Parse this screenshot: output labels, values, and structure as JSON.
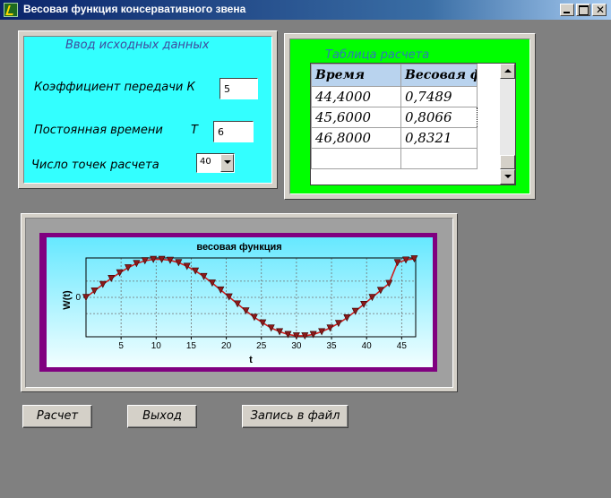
{
  "window": {
    "title": "Весовая функция консервативного звена",
    "controls": [
      "minimize",
      "maximize",
      "close"
    ],
    "close_glyph": "✕"
  },
  "input_panel": {
    "title": "Ввод исходных данных",
    "gain_label": "Коэффициент передачи К",
    "gain_value": "5",
    "time_const_label": "Постоянная времени",
    "time_const_symbol": "T",
    "time_const_value": "6",
    "points_label": "Число точек расчета",
    "points_value": "40"
  },
  "table_panel": {
    "title": "Таблица расчета",
    "columns": [
      "Время",
      "Весовая ф"
    ],
    "rows": [
      [
        "44,4000",
        "0,7489"
      ],
      [
        "45,6000",
        "0,8066"
      ],
      [
        "46,8000",
        "0,8321"
      ],
      [
        "",
        ""
      ]
    ]
  },
  "chart_data": {
    "type": "line",
    "title": "весовая функция",
    "xlabel": "t",
    "ylabel": "W(t)",
    "xlim": [
      0,
      47
    ],
    "ylim": [
      -0.85,
      0.85
    ],
    "xticks": [
      5,
      10,
      15,
      20,
      25,
      30,
      35,
      40,
      45
    ],
    "yticks": [
      0
    ],
    "grid": true,
    "marker": "triangle-down",
    "series": [
      {
        "color": "#cc2020",
        "x": [
          0,
          1.2,
          2.4,
          3.6,
          4.8,
          6,
          7.2,
          8.4,
          9.6,
          10.8,
          12,
          13.2,
          14.4,
          15.6,
          16.8,
          18,
          19.2,
          20.4,
          21.6,
          22.8,
          24,
          25.2,
          26.4,
          27.6,
          28.8,
          30,
          31.2,
          32.4,
          33.6,
          34.8,
          36,
          37.2,
          38.4,
          39.6,
          40.8,
          42,
          43.2,
          44.4,
          45.6,
          46.8
        ],
        "y": [
          0,
          0.14,
          0.28,
          0.41,
          0.53,
          0.64,
          0.73,
          0.79,
          0.82,
          0.82,
          0.8,
          0.75,
          0.67,
          0.57,
          0.45,
          0.31,
          0.16,
          0.01,
          -0.14,
          -0.29,
          -0.43,
          -0.55,
          -0.66,
          -0.74,
          -0.8,
          -0.83,
          -0.83,
          -0.8,
          -0.74,
          -0.66,
          -0.56,
          -0.44,
          -0.3,
          -0.15,
          0.0,
          0.15,
          0.3,
          0.7489,
          0.8066,
          0.8321
        ]
      }
    ]
  },
  "buttons": {
    "calc": "Расчет",
    "exit": "Выход",
    "save": "Запись в файл"
  }
}
